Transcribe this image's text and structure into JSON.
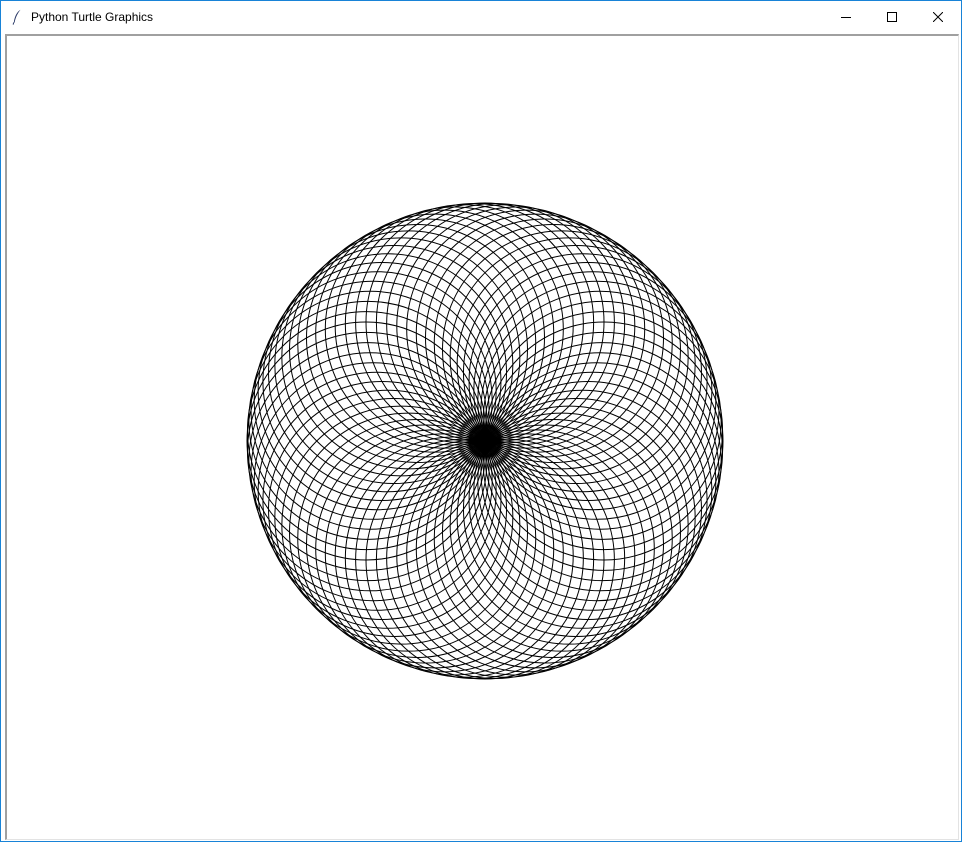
{
  "window": {
    "title": "Python Turtle Graphics",
    "app_icon": "feather-icon",
    "controls": [
      "minimize-icon",
      "maximize-icon",
      "close-icon"
    ]
  },
  "canvas": {
    "background": "#ffffff",
    "pen_color": "#000000",
    "drawing": "spirograph of overlapping circles through a common center",
    "circle_count": 72
  }
}
